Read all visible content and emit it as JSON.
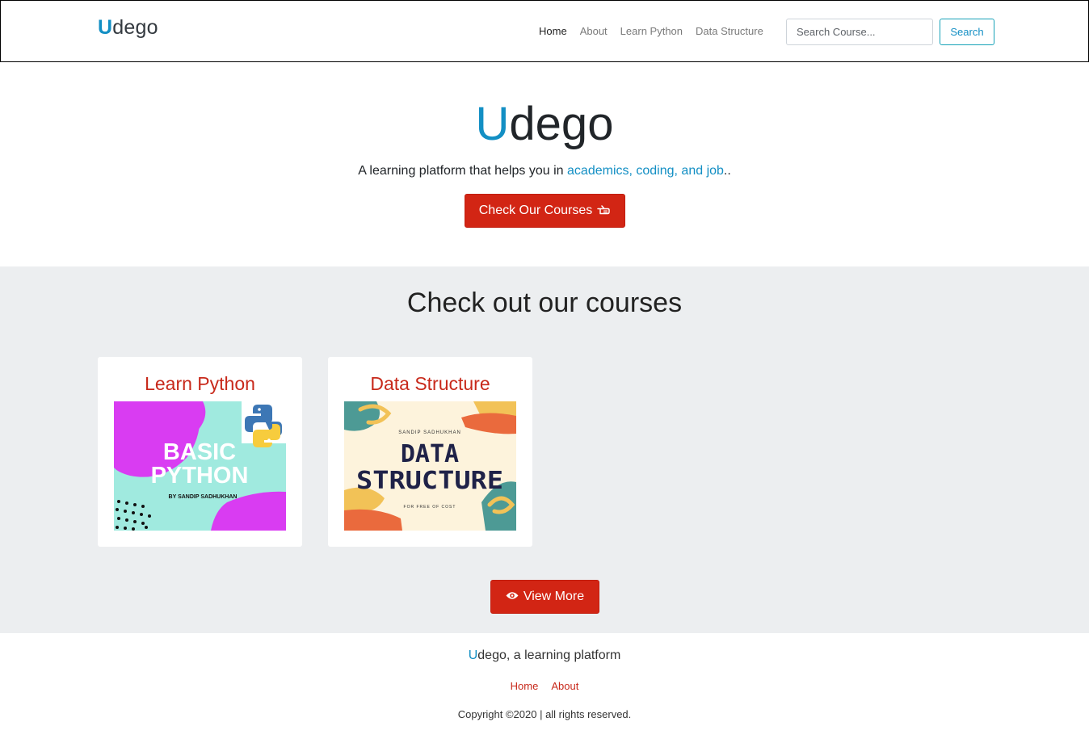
{
  "navbar": {
    "brand_first": "U",
    "brand_rest": "dego",
    "links": [
      {
        "label": "Home",
        "active": true
      },
      {
        "label": "About",
        "active": false
      },
      {
        "label": "Learn Python",
        "active": false
      },
      {
        "label": "Data Structure",
        "active": false
      }
    ],
    "search_placeholder": "Search Course...",
    "search_button": "Search"
  },
  "hero": {
    "title_first": "U",
    "title_rest": "dego",
    "subtitle_prefix": "A learning platform that helps you in ",
    "subtitle_highlight": "academics, coding, and job",
    "subtitle_suffix": "..",
    "cta_label": "Check Our Courses",
    "cta_icon": "pointing-hand-icon"
  },
  "courses": {
    "heading": "Check out our courses",
    "cards": [
      {
        "title": "Learn Python",
        "thumbnail": {
          "line1": "BASIC",
          "line2": "PYTHON",
          "byline": "BY SANDIP SADHUKHAN"
        }
      },
      {
        "title": "Data Structure",
        "thumbnail": {
          "top": "SANDIP SADHUKHAN",
          "line1": "DATA",
          "line2": "STRUCTURE",
          "bottom": "FOR FREE OF COST"
        }
      }
    ],
    "view_more_label": "View More",
    "view_more_icon": "eye-icon"
  },
  "footer": {
    "brand_first": "U",
    "brand_rest": "dego, a learning platform",
    "links": [
      {
        "label": "Home"
      },
      {
        "label": "About"
      }
    ],
    "copyright": "Copyright ©2020 | all rights reserved."
  },
  "colors": {
    "accent_blue": "#138fc4",
    "brand_red": "#d22514",
    "section_gray": "#eceef0"
  }
}
